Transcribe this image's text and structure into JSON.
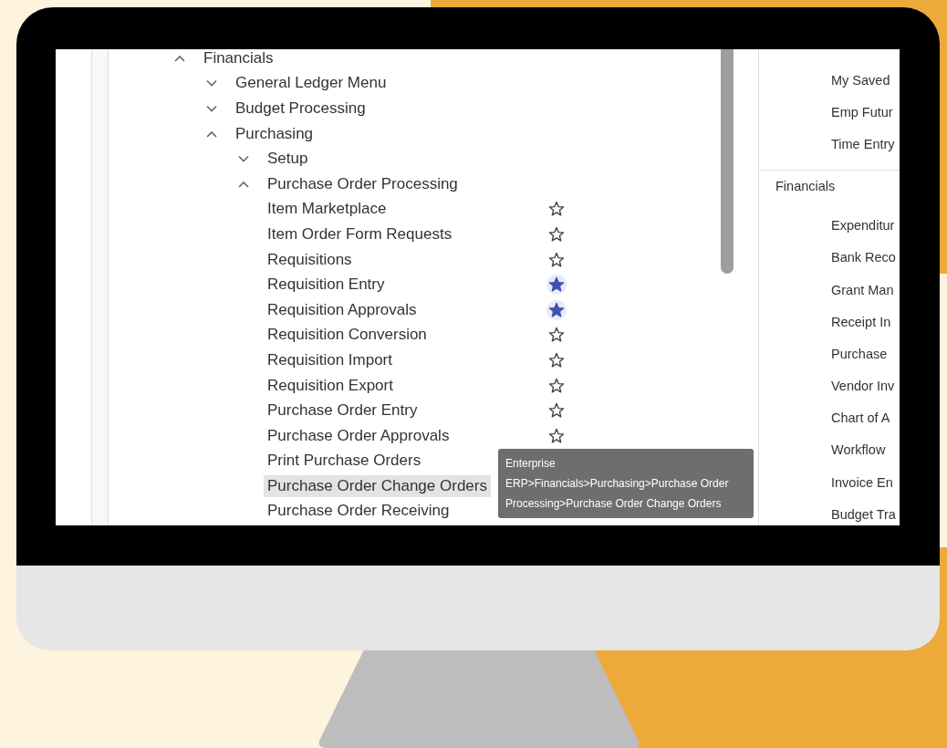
{
  "tree": {
    "items": [
      {
        "kind": "folder",
        "label": "Financials",
        "expanded": true,
        "selected": false,
        "children": [
          {
            "kind": "folder",
            "label": "General Ledger Menu",
            "expanded": false,
            "selected": false
          },
          {
            "kind": "folder",
            "label": "Budget Processing",
            "expanded": false,
            "selected": false
          },
          {
            "kind": "folder",
            "label": "Purchasing",
            "expanded": true,
            "selected": false,
            "children": [
              {
                "kind": "folder",
                "label": "Setup",
                "expanded": false,
                "selected": false
              },
              {
                "kind": "folder",
                "label": "Purchase Order Processing",
                "expanded": true,
                "selected": false,
                "children": [
                  {
                    "kind": "link",
                    "label": "Item Marketplace",
                    "favorite": false,
                    "selected": false
                  },
                  {
                    "kind": "link",
                    "label": "Item Order Form Requests",
                    "favorite": false,
                    "selected": false
                  },
                  {
                    "kind": "link",
                    "label": "Requisitions",
                    "favorite": false,
                    "selected": false
                  },
                  {
                    "kind": "link",
                    "label": "Requisition Entry",
                    "favorite": true,
                    "selected": false
                  },
                  {
                    "kind": "link",
                    "label": "Requisition Approvals",
                    "favorite": true,
                    "selected": false
                  },
                  {
                    "kind": "link",
                    "label": "Requisition Conversion",
                    "favorite": false,
                    "selected": false
                  },
                  {
                    "kind": "link",
                    "label": "Requisition Import",
                    "favorite": false,
                    "selected": false
                  },
                  {
                    "kind": "link",
                    "label": "Requisition Export",
                    "favorite": false,
                    "selected": false
                  },
                  {
                    "kind": "link",
                    "label": "Purchase Order Entry",
                    "favorite": false,
                    "selected": false
                  },
                  {
                    "kind": "link",
                    "label": "Purchase Order Approvals",
                    "favorite": false,
                    "selected": false
                  },
                  {
                    "kind": "link",
                    "label": "Print Purchase Orders",
                    "selected": false
                  },
                  {
                    "kind": "link",
                    "label": "Purchase Order Change Orders",
                    "selected": true
                  },
                  {
                    "kind": "link",
                    "label": "Purchase Order Receiving",
                    "selected": false
                  }
                ]
              }
            ]
          }
        ]
      }
    ]
  },
  "tooltip": {
    "text": "Enterprise ERP>Financials>Purchasing>Purchase Order Processing>Purchase Order Change Orders"
  },
  "quick_panel": {
    "items": [
      "My Saved",
      "Emp Futur",
      "Time Entry"
    ],
    "section_title": "Financials",
    "section_items": [
      "Expenditur",
      "Bank Reco",
      "Grant Man",
      "Receipt In",
      "Purchase",
      "Vendor Inv",
      "Chart of A",
      "Workflow",
      "Invoice En",
      "Budget Tra"
    ]
  }
}
